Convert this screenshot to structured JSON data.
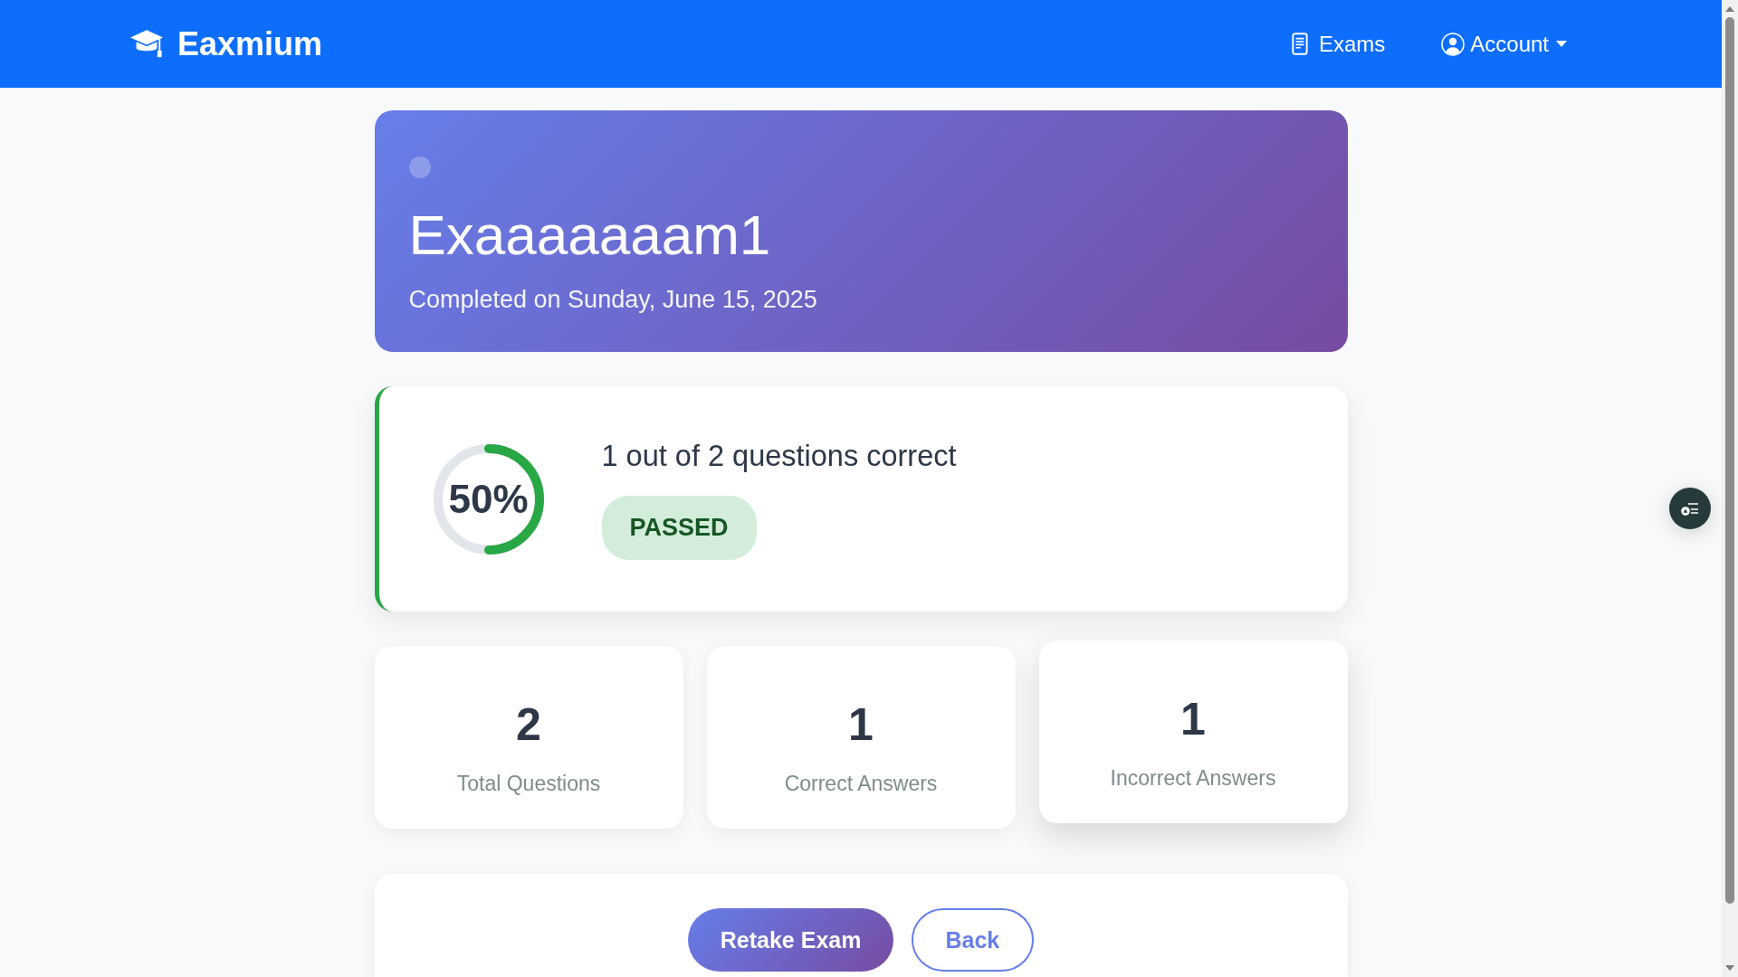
{
  "navbar": {
    "brand": "Eaxmium",
    "links": [
      {
        "label": "Exams",
        "kind": "link"
      },
      {
        "label": "Account",
        "kind": "dropdown"
      }
    ]
  },
  "header": {
    "title": "Exaaaaaaam1",
    "subtitle": "Completed on Sunday, June 15, 2025"
  },
  "score": {
    "level": 0.5,
    "percent": "50%",
    "summary": "1 out of 2 questions correct",
    "status": "PASSED",
    "passed": true
  },
  "stats": [
    {
      "value": "2",
      "label": "Total Questions",
      "hovered": false
    },
    {
      "value": "1",
      "label": "Correct Answers",
      "hovered": false
    },
    {
      "value": "1",
      "label": "Incorrect Answers",
      "hovered": true
    }
  ],
  "actions": [
    {
      "label": "Retake Exam",
      "kind": "primary"
    },
    {
      "label": "Back",
      "kind": "outline"
    }
  ]
}
